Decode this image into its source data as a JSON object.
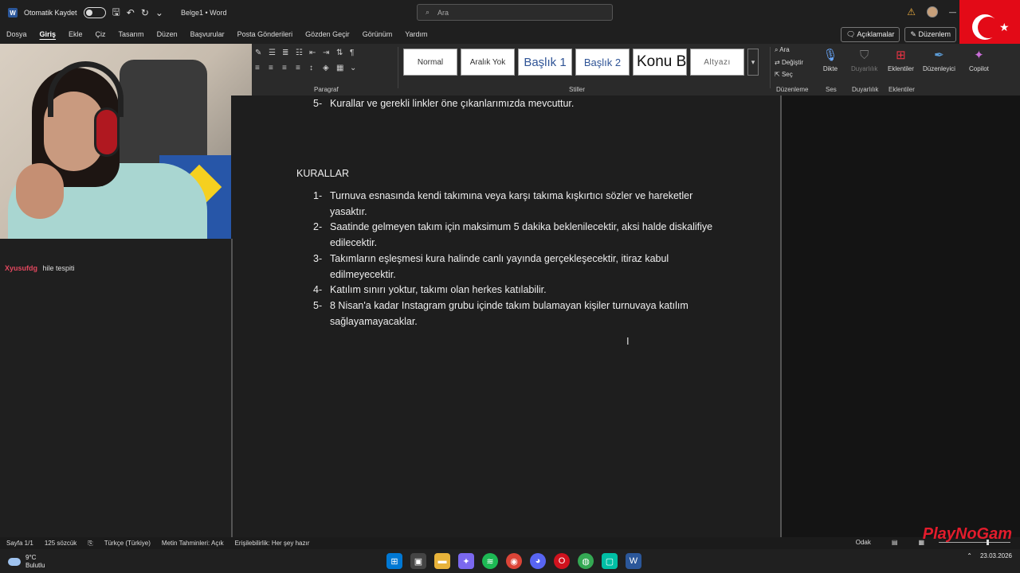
{
  "titlebar": {
    "autosave_label": "Otomatik Kaydet",
    "document_title": "Belge1 • Word",
    "search_placeholder": "Ara"
  },
  "menu": {
    "items": [
      "Dosya",
      "Giriş",
      "Ekle",
      "Çiz",
      "Tasarım",
      "Düzen",
      "Başvurular",
      "Posta Gönderileri",
      "Gözden Geçir",
      "Görünüm",
      "Yardım"
    ],
    "active": "Giriş",
    "comments_button": "Açıklamalar",
    "editing_button": "Düzenlem"
  },
  "ribbon": {
    "styles": [
      "Normal",
      "Aralık Yok",
      "Başlık 1",
      "Başlık 2",
      "Konu B",
      "Altyazı"
    ],
    "group_paragraph": "Paragraf",
    "group_styles": "Stiller",
    "group_editing": "Düzenleme",
    "group_voice": "Ses",
    "group_sensitivity": "Duyarlılık",
    "group_addins": "Eklentiler",
    "find_label": "Ara",
    "replace_label": "Değiştir",
    "select_label": "Seç",
    "dictate_label": "Dikte",
    "sensitivity_label": "Duyarlılık",
    "addins_label": "Eklentiler",
    "editor_label": "Düzenleyici",
    "copilot_label": "Copilot"
  },
  "chat": {
    "user": "Xyusufdg",
    "message": "hile tespiti"
  },
  "document": {
    "previous_item": {
      "num": "5-",
      "text": "Kurallar ve gerekli linkler öne çıkanlarımızda mevcuttur."
    },
    "heading": "KURALLAR",
    "rules": [
      {
        "num": "1-",
        "text": "Turnuva esnasında kendi takımına veya karşı takıma kışkırtıcı sözler ve hareketler yasaktır."
      },
      {
        "num": "2-",
        "text": "Saatinde gelmeyen takım için maksimum 5 dakika beklenilecektir, aksi halde diskalifiye edilecektir."
      },
      {
        "num": "3-",
        "text": "Takımların eşleşmesi kura halinde canlı yayında gerçekleşecektir, itiraz kabul edilmeyecektir."
      },
      {
        "num": "4-",
        "text": "Katılım sınırı yoktur, takımı olan herkes katılabilir."
      },
      {
        "num": "5-",
        "text": "8 Nisan'a kadar Instagram grubu içinde takım bulamayan kişiler turnuvaya katılım sağlayamayacaklar."
      }
    ]
  },
  "statusbar": {
    "page": "Sayfa 1/1",
    "words": "125 sözcük",
    "language": "Türkçe (Türkiye)",
    "predictions": "Metin Tahminleri: Açık",
    "accessibility": "Erişilebilirlik: Her şey hazır",
    "focus": "Odak"
  },
  "taskbar": {
    "temperature": "9°C",
    "weather": "Bulutlu",
    "date": "23.03.2026"
  },
  "watermark": "PlayNoGam",
  "colors": {
    "accent_word": "#2b579a",
    "flag_red": "#e30a17",
    "chat_user": "#e2475e"
  }
}
